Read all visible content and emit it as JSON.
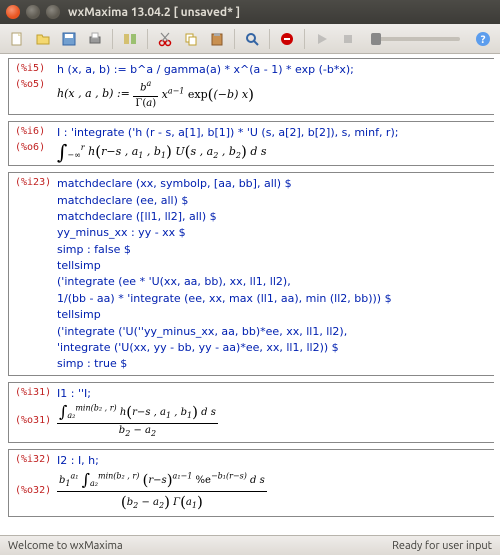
{
  "window": {
    "title": "wxMaxima 13.04.2 [ unsaved* ]"
  },
  "status": {
    "left": "Welcome to wxMaxima",
    "right": "Ready for user input"
  },
  "cells": {
    "i5": {
      "label": "(%i5)",
      "code": "h (x, a, b) := b^a / gamma(a) * x^(a - 1) * exp (-b*x);"
    },
    "o5": {
      "label": "(%o5)",
      "math_prefix": "h(x , a , b) := ",
      "frac_num": "bᵃ",
      "frac_den": "Γ(a)",
      "math_suffix": " xᵃ⁻¹ exp((−b) x)"
    },
    "i6": {
      "label": "(%i6)",
      "code": "I : 'integrate ('h (r - s, a[1], b[1]) * 'U (s, a[2], b[2]), s, minf, r);"
    },
    "o6": {
      "label": "(%o6)",
      "lower": "−∞",
      "upper": "r",
      "body": "h(r−s , a₁ , b₁) U(s , a₂ , b₂) d s"
    },
    "i23": {
      "label": "(%i23)",
      "lines": [
        "matchdeclare (xx, symbolp, [aa, bb], all) $",
        "matchdeclare (ee, all) $",
        "matchdeclare ([ll1, ll2], all) $",
        "yy_minus_xx : yy - xx $",
        "simp : false $",
        "tellsimp",
        "('integrate (ee * 'U(xx, aa, bb), xx, ll1, ll2),",
        "1/(bb - aa) * 'integrate (ee, xx, max (ll1, aa), min (ll2, bb))) $",
        "tellsimp",
        "('integrate ('U(''yy_minus_xx, aa, bb)*ee, xx, ll1, ll2),",
        "'integrate ('U(xx, yy - bb, yy - aa)*ee, xx, ll1, ll2)) $",
        "simp : true $"
      ]
    },
    "i31": {
      "label": "(%i31)",
      "code": "I1 : ''I;"
    },
    "o31": {
      "label": "(%o31)",
      "upper": "min(b₂ , r)",
      "lower": "a₂",
      "num_body": "h(r−s , a₁ , b₁) d s",
      "den": "b₂ − a₂"
    },
    "i32": {
      "label": "(%i32)",
      "code": "I2 : I, h;"
    },
    "o32": {
      "label": "(%o32)",
      "coef": "b₁ᵃ¹",
      "upper": "min(b₂ , r)",
      "lower": "a₂",
      "num_body": "(r−s)ᵃ¹⁻¹ %e⁻ᵇ¹⁽ʳ⁻ˢ⁾ d s",
      "den": "(b₂ − a₂) Γ(a₁)"
    }
  }
}
